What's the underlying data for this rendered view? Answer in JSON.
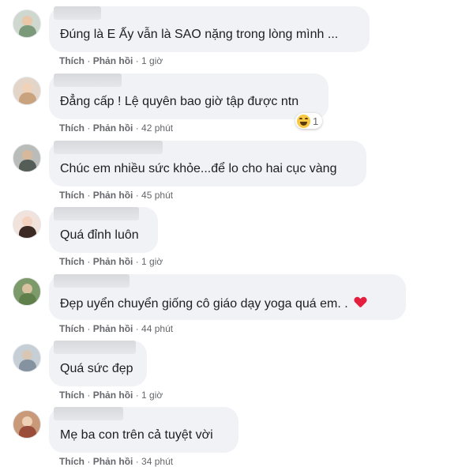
{
  "comments": [
    {
      "text": "Đúng là E Ấy vẫn là SAO nặng trong lòng mình ...",
      "time": "1 giờ",
      "heart": false
    },
    {
      "text": "Đẳng cấp ! Lệ quyên bao giờ tập được ntn",
      "time": "42 phút",
      "heart": false,
      "reaction_count": "1"
    },
    {
      "text": "Chúc em nhiều sức khỏe...để lo cho hai cục vàng",
      "time": "45 phút",
      "heart": false
    },
    {
      "text": "Quá đỉnh luôn",
      "time": "1 giờ",
      "heart": false
    },
    {
      "text": "Đẹp uyển chuyển giống cô giáo dạy yoga quá em. .",
      "time": "44 phút",
      "heart": true
    },
    {
      "text": "Quá sức đẹp",
      "time": "1 giờ",
      "heart": false
    },
    {
      "text": "Mẹ ba con trên cả tuyệt vời",
      "time": "34 phút",
      "heart": false
    }
  ],
  "actions": {
    "like": "Thích",
    "reply": "Phản hồi",
    "separator": "·"
  },
  "colors": {
    "bubble": "#f0f2f5",
    "meta": "#65676b",
    "heart": "#e41e3f",
    "haha": "#f7c944"
  },
  "icons": {
    "reaction": "haha-emoji-icon",
    "heart": "heart-emoji-icon"
  }
}
